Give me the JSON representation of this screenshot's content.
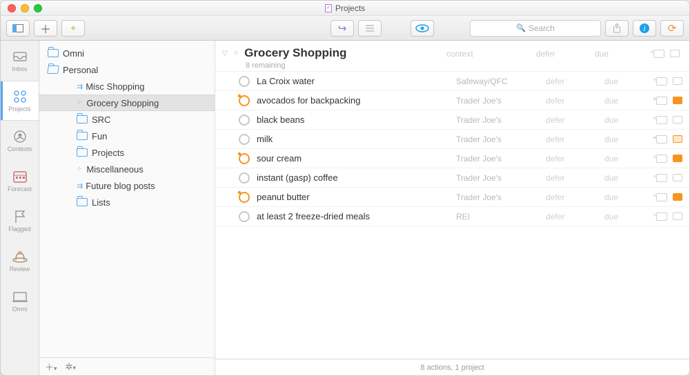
{
  "window": {
    "title": "Projects"
  },
  "toolbar": {
    "search_placeholder": "Search"
  },
  "perspectives": [
    {
      "id": "inbox",
      "label": "Inbox"
    },
    {
      "id": "projects",
      "label": "Projects"
    },
    {
      "id": "contexts",
      "label": "Contexts"
    },
    {
      "id": "forecast",
      "label": "Forecast"
    },
    {
      "id": "flagged",
      "label": "Flagged"
    },
    {
      "id": "review",
      "label": "Review"
    },
    {
      "id": "omni",
      "label": "Omni"
    }
  ],
  "active_perspective": "projects",
  "tree": [
    {
      "label": "Omni",
      "kind": "folder",
      "level": 0
    },
    {
      "label": "Personal",
      "kind": "folder-open",
      "level": 0
    },
    {
      "label": "Misc Shopping",
      "kind": "parallel",
      "level": 2
    },
    {
      "label": "Grocery Shopping",
      "kind": "single",
      "level": 2,
      "selected": true
    },
    {
      "label": "SRC",
      "kind": "folder",
      "level": 2
    },
    {
      "label": "Fun",
      "kind": "folder",
      "level": 2
    },
    {
      "label": "Projects",
      "kind": "folder",
      "level": 2
    },
    {
      "label": "Miscellaneous",
      "kind": "single",
      "level": 2
    },
    {
      "label": "Future blog posts",
      "kind": "parallel",
      "level": 2
    },
    {
      "label": "Lists",
      "kind": "folder",
      "level": 2
    }
  ],
  "project": {
    "title": "Grocery Shopping",
    "subtitle": "8 remaining",
    "columns": {
      "context": "context",
      "defer": "defer",
      "due": "due"
    }
  },
  "tasks": [
    {
      "title": "La Croix water",
      "context": "Safeway/QFC",
      "flagged": false,
      "flag_tail": "off",
      "note": false
    },
    {
      "title": "avocados for backpacking",
      "context": "Trader Joe's",
      "flagged": true,
      "flag_tail": "on",
      "note": true
    },
    {
      "title": "black beans",
      "context": "Trader Joe's",
      "flagged": false,
      "flag_tail": "off",
      "note": false
    },
    {
      "title": "milk",
      "context": "Trader Joe's",
      "flagged": false,
      "flag_tail": "sel",
      "note": true
    },
    {
      "title": "sour cream",
      "context": "Trader Joe's",
      "flagged": true,
      "flag_tail": "on",
      "note": false
    },
    {
      "title": "instant (gasp) coffee",
      "context": "Trader Joe's",
      "flagged": false,
      "flag_tail": "off",
      "note": false
    },
    {
      "title": "peanut butter",
      "context": "Trader Joe's",
      "flagged": true,
      "flag_tail": "on",
      "note": false
    },
    {
      "title": "at least 2 freeze-dried meals",
      "context": "REI",
      "flagged": false,
      "flag_tail": "off",
      "note": false
    }
  ],
  "defer_label": "defer",
  "due_label": "due",
  "statusbar": "8 actions, 1 project"
}
